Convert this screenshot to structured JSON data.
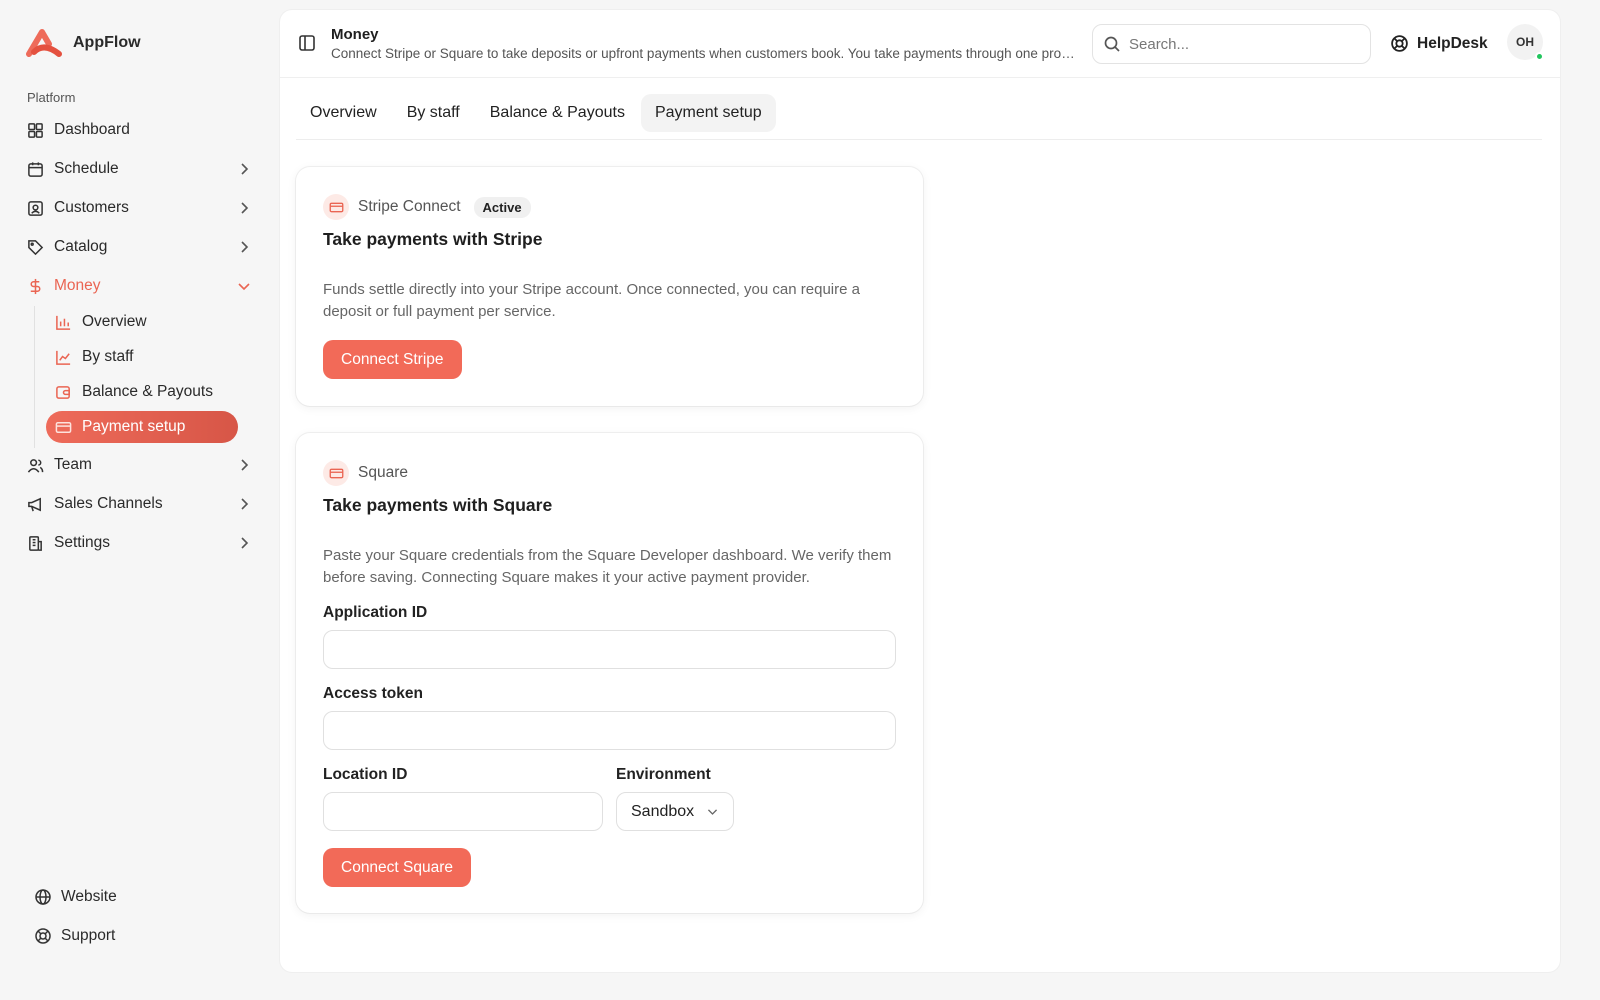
{
  "brand": {
    "name": "AppFlow"
  },
  "sidebar": {
    "section": "Platform",
    "items": [
      {
        "label": "Dashboard",
        "icon": "dashboard-icon"
      },
      {
        "label": "Schedule",
        "icon": "calendar-icon"
      },
      {
        "label": "Customers",
        "icon": "contact-icon"
      },
      {
        "label": "Catalog",
        "icon": "tag-icon"
      },
      {
        "label": "Money",
        "icon": "dollar-icon"
      },
      {
        "label": "Team",
        "icon": "users-icon"
      },
      {
        "label": "Sales Channels",
        "icon": "megaphone-icon"
      },
      {
        "label": "Settings",
        "icon": "building-icon"
      }
    ],
    "money_sub": [
      {
        "label": "Overview",
        "icon": "bar-chart-icon"
      },
      {
        "label": "By staff",
        "icon": "line-chart-icon"
      },
      {
        "label": "Balance & Payouts",
        "icon": "wallet-icon"
      },
      {
        "label": "Payment setup",
        "icon": "credit-card-icon"
      }
    ],
    "footer": [
      {
        "label": "Website",
        "icon": "globe-icon"
      },
      {
        "label": "Support",
        "icon": "lifebuoy-icon"
      }
    ]
  },
  "header": {
    "title": "Money",
    "subtitle": "Connect Stripe or Square to take deposits or upfront payments when customers book. You take payments through one provider at a time.",
    "search_placeholder": "Search...",
    "helpdesk": "HelpDesk",
    "avatar_initials": "OH"
  },
  "tabs": [
    {
      "label": "Overview"
    },
    {
      "label": "By staff"
    },
    {
      "label": "Balance & Payouts"
    },
    {
      "label": "Payment setup"
    }
  ],
  "stripe": {
    "provider": "Stripe Connect",
    "badge": "Active",
    "title": "Take payments with Stripe",
    "description": "Funds settle directly into your Stripe account. Once connected, you can require a deposit or full payment per service.",
    "button": "Connect Stripe"
  },
  "square": {
    "provider": "Square",
    "title": "Take payments with Square",
    "description": "Paste your Square credentials from the Square Developer dashboard. We verify them before saving. Connecting Square makes it your active payment provider.",
    "app_id_label": "Application ID",
    "app_id_value": "",
    "token_label": "Access token",
    "token_value": "",
    "location_label": "Location ID",
    "location_value": "",
    "env_label": "Environment",
    "env_value": "Sandbox",
    "button": "Connect Square"
  },
  "colors": {
    "accent": "#f26a58",
    "active_text": "#ea6553",
    "online": "#22c55e"
  }
}
